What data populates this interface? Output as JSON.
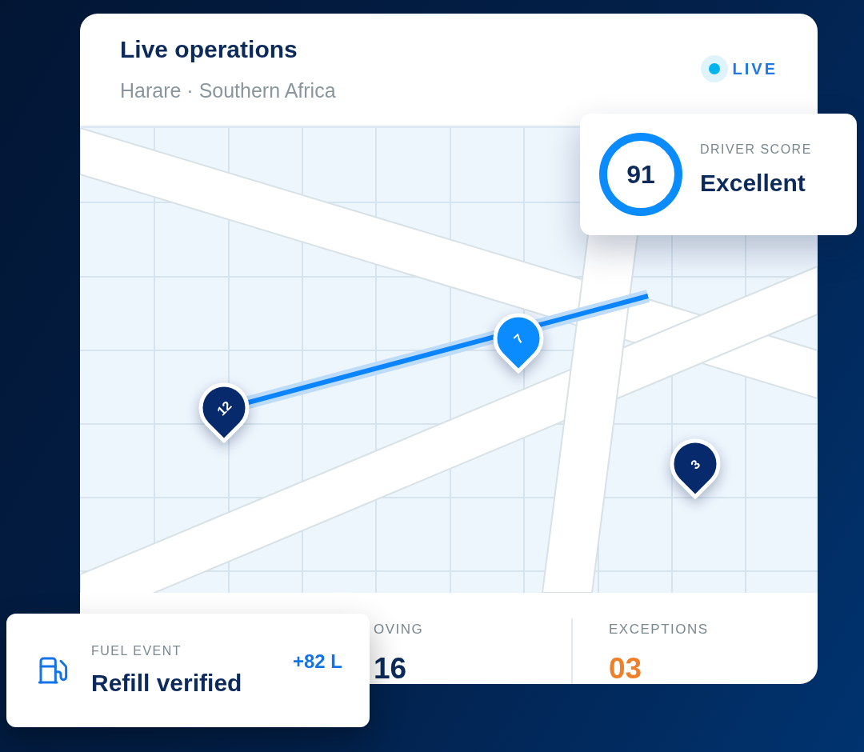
{
  "header": {
    "title": "Live operations",
    "subtitle": "Harare · Southern Africa",
    "badge": "LIVE"
  },
  "map": {
    "pins": [
      {
        "label": "12",
        "kind": "dark"
      },
      {
        "label": "7",
        "kind": "active"
      },
      {
        "label": "3",
        "kind": "dark"
      }
    ]
  },
  "driver_score": {
    "label": "DRIVER SCORE",
    "value": "91",
    "rating": "Excellent"
  },
  "stats": [
    {
      "label": "OVING",
      "value": "16",
      "kind": "normal"
    },
    {
      "label": "EXCEPTIONS",
      "value": "03",
      "kind": "alert"
    }
  ],
  "fuel_event": {
    "label": "FUEL EVENT",
    "title": "Refill verified",
    "amount": "+82 L"
  }
}
